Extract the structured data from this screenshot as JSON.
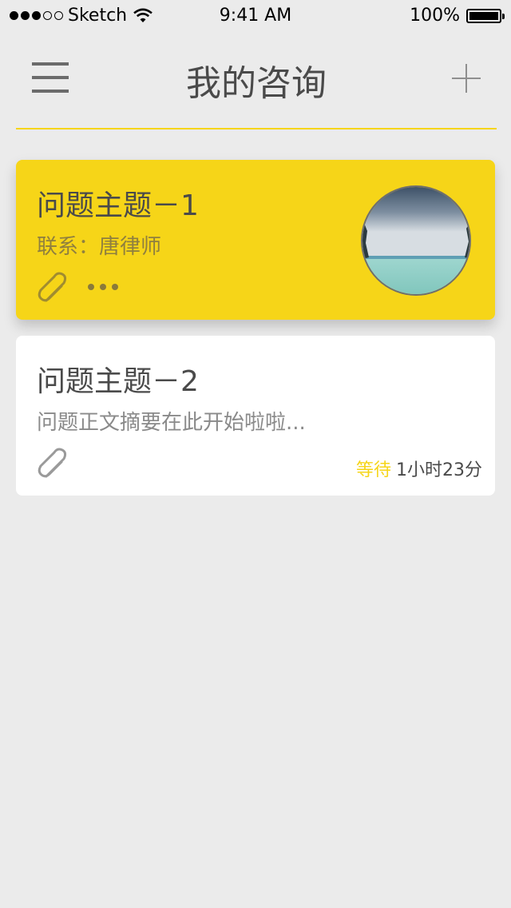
{
  "status_bar": {
    "carrier": "Sketch",
    "time": "9:41 AM",
    "battery": "100%"
  },
  "nav": {
    "title": "我的咨询"
  },
  "consultations": [
    {
      "title": "问题主题－1",
      "subtitle": "联系：唐律师"
    },
    {
      "title": "问题主题－2",
      "subtitle": "问题正文摘要在此开始啦啦...",
      "status_label": "等待",
      "duration": "1小时23分"
    }
  ],
  "colors": {
    "accent": "#f6d518",
    "background": "#ebebeb",
    "text_primary": "#4a4a4a",
    "text_secondary": "#8a8a8a"
  },
  "icons": {
    "menu": "hamburger-menu-icon",
    "add": "plus-icon",
    "attachment": "paperclip-icon",
    "more": "more-dots-icon"
  }
}
